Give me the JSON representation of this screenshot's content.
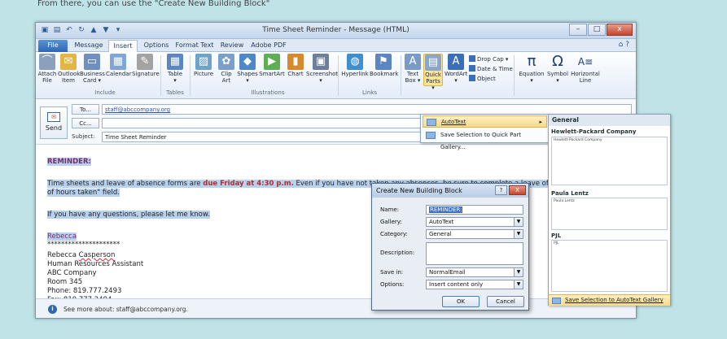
{
  "caption": "From there, you can use the \"Create New Building Block\"",
  "window": {
    "title": "Time Sheet Reminder - Message (HTML)"
  },
  "tabs": [
    "File",
    "Message",
    "Insert",
    "Options",
    "Format Text",
    "Review",
    "Adobe PDF"
  ],
  "ribbon": {
    "include": {
      "group": "Include",
      "buttons": [
        {
          "l1": "Attach",
          "l2": "File"
        },
        {
          "l1": "Outlook",
          "l2": "Item"
        },
        {
          "l1": "Business",
          "l2": "Card ▾"
        },
        {
          "l1": "Calendar",
          "l2": ""
        },
        {
          "l1": "Signature",
          "l2": ""
        }
      ]
    },
    "tables": {
      "group": "Tables",
      "buttons": [
        {
          "l1": "Table",
          "l2": "▾"
        }
      ]
    },
    "illustrations": {
      "group": "Illustrations",
      "buttons": [
        {
          "l1": "Picture",
          "l2": ""
        },
        {
          "l1": "Clip",
          "l2": "Art"
        },
        {
          "l1": "Shapes",
          "l2": "▾"
        },
        {
          "l1": "SmartArt",
          "l2": ""
        },
        {
          "l1": "Chart",
          "l2": ""
        },
        {
          "l1": "Screenshot",
          "l2": "▾"
        }
      ]
    },
    "links": {
      "group": "Links",
      "buttons": [
        {
          "l1": "Hyperlink",
          "l2": ""
        },
        {
          "l1": "Bookmark",
          "l2": ""
        }
      ]
    },
    "text": {
      "buttons": [
        {
          "l1": "Text",
          "l2": "Box ▾"
        },
        {
          "l1": "Quick",
          "l2": "Parts ▾"
        },
        {
          "l1": "WordArt",
          "l2": "▾"
        }
      ],
      "small": [
        "Drop Cap ▾",
        "Date & Time",
        "Object"
      ]
    },
    "symbols": {
      "buttons": [
        {
          "l1": "Equation",
          "l2": "▾"
        },
        {
          "l1": "Symbol",
          "l2": "▾"
        },
        {
          "l1": "Horizontal",
          "l2": "Line"
        }
      ]
    }
  },
  "header": {
    "send_label": "Send",
    "to_label": "To...",
    "to_value": "staff@abccompany.org",
    "cc_label": "Cc...",
    "cc_value": "",
    "subject_label": "Subject:",
    "subject_value": "Time Sheet Reminder"
  },
  "body": {
    "reminder": "REMINDER:",
    "line1_a": "Time sheets and leave of absence forms are ",
    "line1_due": "due Friday at 4:30 p.m.",
    "line1_b": " Even if you have not taken any absences, be sure to complete a leave of absence form and ente",
    "line2": "of hours taken\" field.",
    "line3": "If you have any questions, please let me know.",
    "sig_first": "Rebecca",
    "stars": "*********************",
    "sig_name_first": "Rebecca ",
    "sig_name_last": "Casperson",
    "sig_title": "Human Resources Assistant",
    "sig_company": "ABC Company",
    "sig_room": "Room 345",
    "sig_phone": "Phone: 819.777.2493",
    "sig_fax": "Fax: 819.777.2494"
  },
  "infobar": {
    "text": "See more about: staff@abccompany.org."
  },
  "quick_parts_menu": {
    "items": [
      "AutoText",
      "Save Selection to Quick Part Gallery..."
    ]
  },
  "autotext_gallery": {
    "header": "General",
    "entries": [
      {
        "name": "Hewlett-Packard Company",
        "preview": "Hewlett-Packard Company"
      },
      {
        "name": "Paula Lentz",
        "preview": "Paula Lentz"
      },
      {
        "name": "PJL",
        "preview": "PJL"
      }
    ],
    "footer": "Save Selection to AutoText Gallery"
  },
  "dialog": {
    "title": "Create New Building Block",
    "help": "?",
    "close": "X",
    "name_label": "Name:",
    "name_value": "REMINDER:",
    "gallery_label": "Gallery:",
    "gallery_value": "AutoText",
    "category_label": "Category:",
    "category_value": "General",
    "description_label": "Description:",
    "description_value": "",
    "savein_label": "Save in:",
    "savein_value": "NormalEmail",
    "options_label": "Options:",
    "options_value": "Insert content only",
    "ok": "OK",
    "cancel": "Cancel"
  }
}
